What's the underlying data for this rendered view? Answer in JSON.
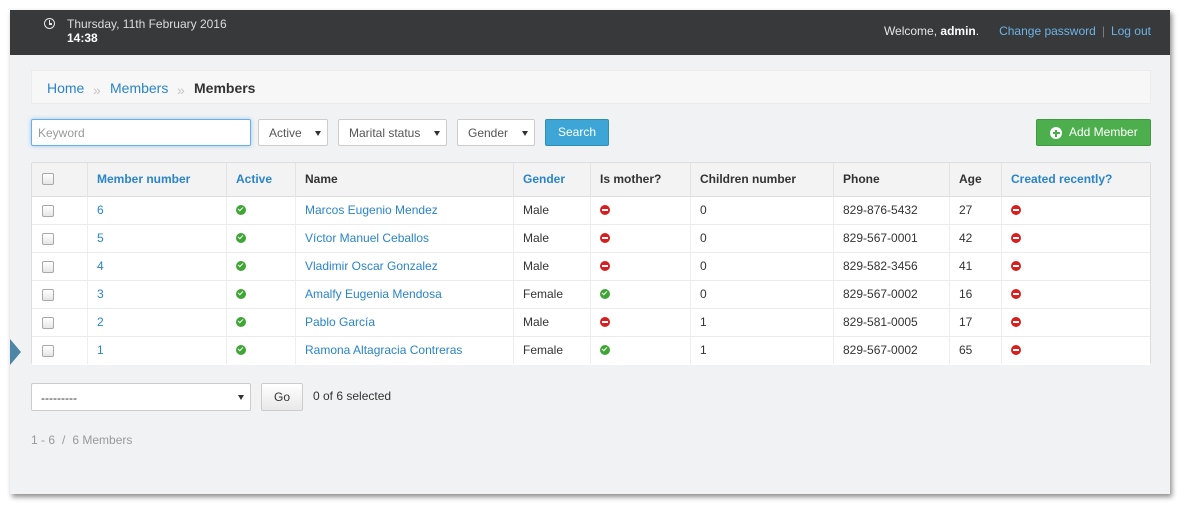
{
  "topbar": {
    "date": "Thursday, 11th February 2016",
    "time": "14:38",
    "welcome_prefix": "Welcome, ",
    "username": "admin",
    "welcome_suffix": ".",
    "change_password": "Change password",
    "separator": "|",
    "logout": "Log out"
  },
  "breadcrumb": {
    "items": [
      "Home",
      "Members",
      "Members"
    ],
    "separator": "»"
  },
  "filters": {
    "keyword_placeholder": "Keyword",
    "active": "Active",
    "marital_status": "Marital status",
    "gender": "Gender",
    "search_label": "Search",
    "add_label": "Add Member"
  },
  "table": {
    "headers": [
      "Member number",
      "Active",
      "Name",
      "Gender",
      "Is mother?",
      "Children number",
      "Phone",
      "Age",
      "Created recently?"
    ],
    "rows": [
      {
        "number": "6",
        "active": "yes",
        "name": "Marcos Eugenio Mendez",
        "gender": "Male",
        "mother": "no",
        "children": "0",
        "phone": "829-876-5432",
        "age": "27",
        "recent": "no"
      },
      {
        "number": "5",
        "active": "yes",
        "name": "Víctor Manuel Ceballos",
        "gender": "Male",
        "mother": "no",
        "children": "0",
        "phone": "829-567-0001",
        "age": "42",
        "recent": "no"
      },
      {
        "number": "4",
        "active": "yes",
        "name": "Vladimir Oscar Gonzalez",
        "gender": "Male",
        "mother": "no",
        "children": "0",
        "phone": "829-582-3456",
        "age": "41",
        "recent": "no"
      },
      {
        "number": "3",
        "active": "yes",
        "name": "Amalfy Eugenia Mendosa",
        "gender": "Female",
        "mother": "yes",
        "children": "0",
        "phone": "829-567-0002",
        "age": "16",
        "recent": "no"
      },
      {
        "number": "2",
        "active": "yes",
        "name": "Pablo García",
        "gender": "Male",
        "mother": "no",
        "children": "1",
        "phone": "829-581-0005",
        "age": "17",
        "recent": "no"
      },
      {
        "number": "1",
        "active": "yes",
        "name": "Ramona Altagracia Contreras",
        "gender": "Female",
        "mother": "yes",
        "children": "1",
        "phone": "829-567-0002",
        "age": "65",
        "recent": "no"
      }
    ]
  },
  "actions": {
    "select_value": "---------",
    "go_label": "Go",
    "selected_text": "0 of 6 selected"
  },
  "pagination": {
    "range": "1 - 6",
    "slash": "/",
    "total": "6 Members"
  },
  "colors": {
    "topbar": "#37393b",
    "link": "#2a84c8",
    "search_button": "#3ea6d6",
    "add_button": "#4cae4c",
    "yes": "#3fa535",
    "no": "#d81e1e"
  }
}
